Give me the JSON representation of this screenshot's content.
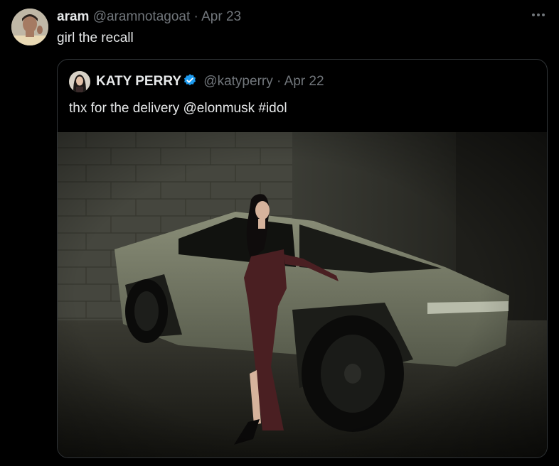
{
  "tweet": {
    "display_name": "aram",
    "handle": "@aramnotagoat",
    "separator": "·",
    "date": "Apr 23",
    "text": "girl the recall",
    "more_icon": "more-horizontal-icon"
  },
  "quoted_tweet": {
    "display_name": "KATY PERRY",
    "verified_icon": "verified-badge-icon",
    "verified_color": "#1d9bf0",
    "handle": "@katyperry",
    "separator": "·",
    "date": "Apr 22",
    "text": "thx for the delivery @elonmusk #idol"
  },
  "colors": {
    "background": "#000000",
    "text_primary": "#e7e9ea",
    "text_muted": "#71767b",
    "border": "#2f3336"
  }
}
